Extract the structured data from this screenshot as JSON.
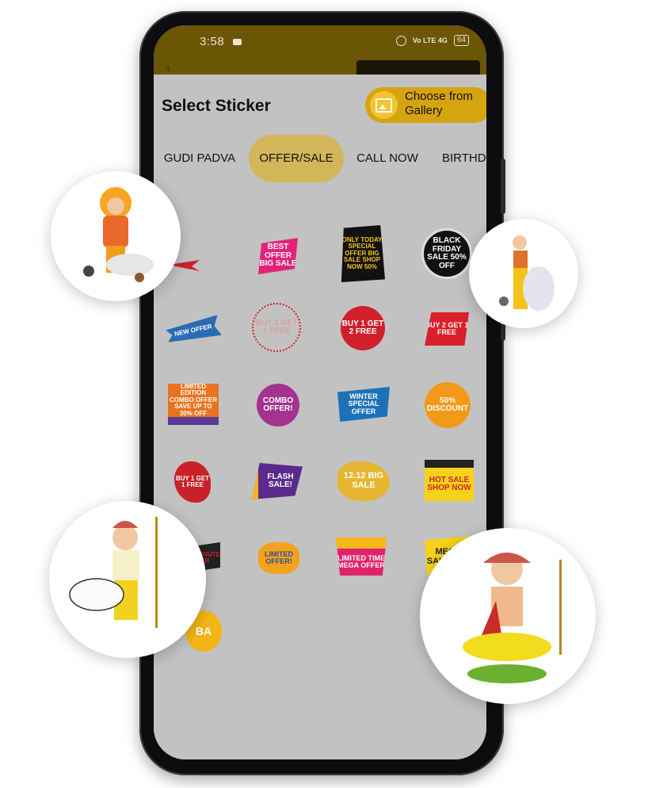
{
  "status_bar": {
    "time": "3:58",
    "network": "Vo LTE 4G",
    "battery": "64"
  },
  "sheet": {
    "title": "Select Sticker",
    "gallery_button": "Choose from Gallery"
  },
  "tabs": [
    {
      "label": "GUDI PADVA",
      "active": false
    },
    {
      "label": "OFFER/SALE",
      "active": true
    },
    {
      "label": "CALL NOW",
      "active": false
    },
    {
      "label": "BIRTHD",
      "active": false
    }
  ],
  "stickers": [
    {
      "text": "",
      "kind": "ribbon-red"
    },
    {
      "text": "BEST OFFER BIG SALE",
      "kind": "pink-banner"
    },
    {
      "text": "ONLY TODAY SPECIAL OFFER BIG SALE SHOP NOW 50%",
      "kind": "yellow-black"
    },
    {
      "text": "BLACK FRIDAY SALE 50% OFF",
      "kind": "black-circle"
    },
    {
      "text": "NEW OFFER",
      "kind": "blue-ribbon"
    },
    {
      "text": "BUY 1 GET 1 FREE",
      "kind": "dotted-circle"
    },
    {
      "text": "BUY 1 GET 2 FREE",
      "kind": "red-circle"
    },
    {
      "text": "BUY 2 GET 1 FREE",
      "kind": "red-speed"
    },
    {
      "text": "LIMITED EDITION COMBO OFFER SAVE UP TO 30% OFF",
      "kind": "combo-orange"
    },
    {
      "text": "COMBO OFFER!",
      "kind": "purple-circle"
    },
    {
      "text": "WINTER SPECIAL OFFER",
      "kind": "winter-blue"
    },
    {
      "text": "50% DISCOUNT",
      "kind": "orange-circle"
    },
    {
      "text": "BUY 1 GET 1 FREE",
      "kind": "red-brush"
    },
    {
      "text": "FLASH SALE!",
      "kind": "flash-purple"
    },
    {
      "text": "12.12 BIG SALE",
      "kind": "gold-blob"
    },
    {
      "text": "HOT SALE SHOP NOW",
      "kind": "hot-sale"
    },
    {
      "text": "LAST MINUTE OFFER",
      "kind": "last-minute"
    },
    {
      "text": "LIMITED OFFER!",
      "kind": "limited-blue"
    },
    {
      "text": "LIMITED TIME MEGA OFFER",
      "kind": "mega-offer"
    },
    {
      "text": "MEGA SALE 20%",
      "kind": "mega-sale"
    },
    {
      "text": "BA",
      "kind": "partial"
    }
  ],
  "colors": {
    "status_bar": "#6b5606",
    "accent": "#d5a50f",
    "tab_active": "#d4b65a",
    "sheet": "#c2c2c2"
  },
  "decor": {
    "bubbles": [
      "deity-illustration-1",
      "deity-illustration-2",
      "deity-illustration-3",
      "deity-illustration-4"
    ]
  }
}
